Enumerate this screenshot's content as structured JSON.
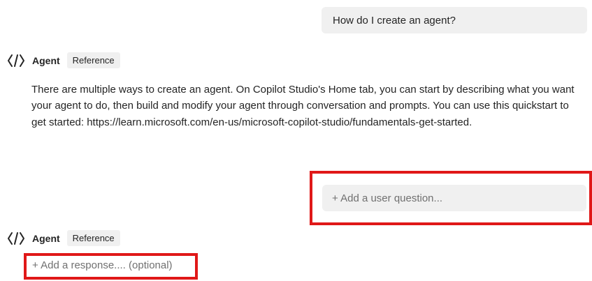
{
  "user_message": "How do I create an agent?",
  "agent_turn_1": {
    "name": "Agent",
    "badge": "Reference",
    "response": "There are multiple ways to create an agent. On Copilot Studio's Home tab, you can start by describing what you want your agent to do, then build and modify your agent through conversation and prompts. You can use this quickstart to get started: https://learn.microsoft.com/en-us/microsoft-copilot-studio/fundamentals-get-started."
  },
  "add_user_question": "+ Add a user question...",
  "agent_turn_2": {
    "name": "Agent",
    "badge": "Reference",
    "add_response": "+ Add a response.... (optional)"
  },
  "colors": {
    "highlight": "#e01818",
    "bubble_bg": "#f0f0f0",
    "placeholder_text": "#707070"
  },
  "icons": {
    "agent": "code-bracket-icon"
  }
}
